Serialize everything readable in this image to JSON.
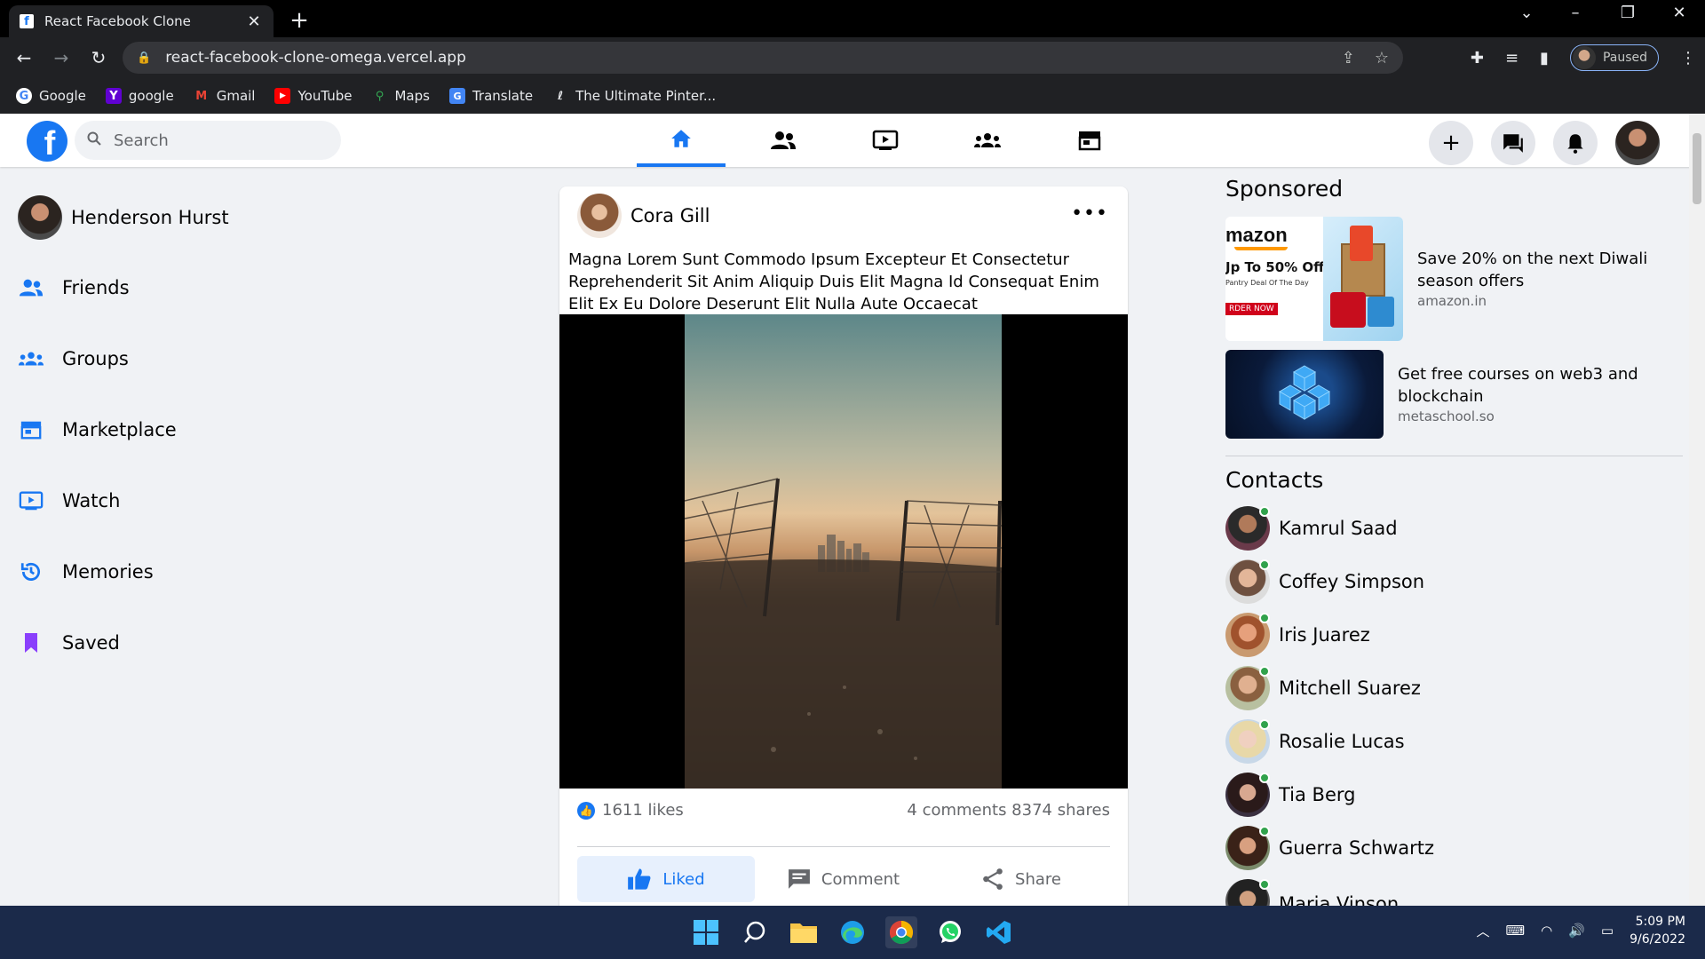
{
  "browser": {
    "tab_title": "React Facebook Clone",
    "tab_favicon": "f",
    "url": "react-facebook-clone-omega.vercel.app",
    "profile_status": "Paused",
    "bookmarks": [
      {
        "label": "Google",
        "icon": "google-icon",
        "color": "#4285f4"
      },
      {
        "label": "google",
        "icon": "yahoo-icon",
        "color": "#6001d2"
      },
      {
        "label": "Gmail",
        "icon": "gmail-icon",
        "color": "#ea4335"
      },
      {
        "label": "YouTube",
        "icon": "youtube-icon",
        "color": "#ff0000"
      },
      {
        "label": "Maps",
        "icon": "maps-icon",
        "color": "#34a853"
      },
      {
        "label": "Translate",
        "icon": "translate-icon",
        "color": "#4285f4"
      },
      {
        "label": "The Ultimate Pinter...",
        "icon": "pinterest-icon",
        "color": "#e8eaed"
      }
    ]
  },
  "header": {
    "search_placeholder": "Search",
    "brand_color": "#1877f2"
  },
  "sidebar": {
    "user_name": "Henderson Hurst",
    "items": [
      {
        "label": "Friends",
        "icon": "friends-icon",
        "color": "#1877f2"
      },
      {
        "label": "Groups",
        "icon": "groups-icon",
        "color": "#1877f2"
      },
      {
        "label": "Marketplace",
        "icon": "marketplace-icon",
        "color": "#1877f2"
      },
      {
        "label": "Watch",
        "icon": "watch-icon",
        "color": "#1877f2"
      },
      {
        "label": "Memories",
        "icon": "memories-icon",
        "color": "#1877f2"
      },
      {
        "label": "Saved",
        "icon": "saved-icon",
        "color": "#8a3ffc"
      }
    ]
  },
  "post": {
    "author": "Cora Gill",
    "text": "Magna Lorem Sunt Commodo Ipsum Excepteur Et Consectetur Reprehenderit Sit Anim Aliquip Duis Elit Magna Id Consequat Enim Elit Ex Eu Dolore Deserunt Elit Nulla Aute Occaecat",
    "likes": "1611 likes",
    "comments_shares": "4 comments 8374 shares",
    "like_label": "Liked",
    "comment_label": "Comment",
    "share_label": "Share"
  },
  "sponsored": {
    "title": "Sponsored",
    "ads": [
      {
        "title": "Save 20% on the next Diwali season offers",
        "source": "amazon.in",
        "img_brand": "mazon",
        "img_offer": "Jp To 50% Off",
        "img_sub": "Pantry Deal Of The Day",
        "img_cta": "RDER NOW"
      },
      {
        "title": "Get free courses on web3 and blockchain",
        "source": "metaschool.so"
      }
    ]
  },
  "contacts": {
    "title": "Contacts",
    "items": [
      {
        "name": "Kamrul Saad",
        "online": true
      },
      {
        "name": "Coffey Simpson",
        "online": true
      },
      {
        "name": "Iris Juarez",
        "online": true
      },
      {
        "name": "Mitchell Suarez",
        "online": true
      },
      {
        "name": "Rosalie Lucas",
        "online": true
      },
      {
        "name": "Tia Berg",
        "online": true
      },
      {
        "name": "Guerra Schwartz",
        "online": true
      },
      {
        "name": "Maria Vinson",
        "online": true
      }
    ]
  },
  "taskbar": {
    "time": "5:09 PM",
    "date": "9/6/2022"
  }
}
